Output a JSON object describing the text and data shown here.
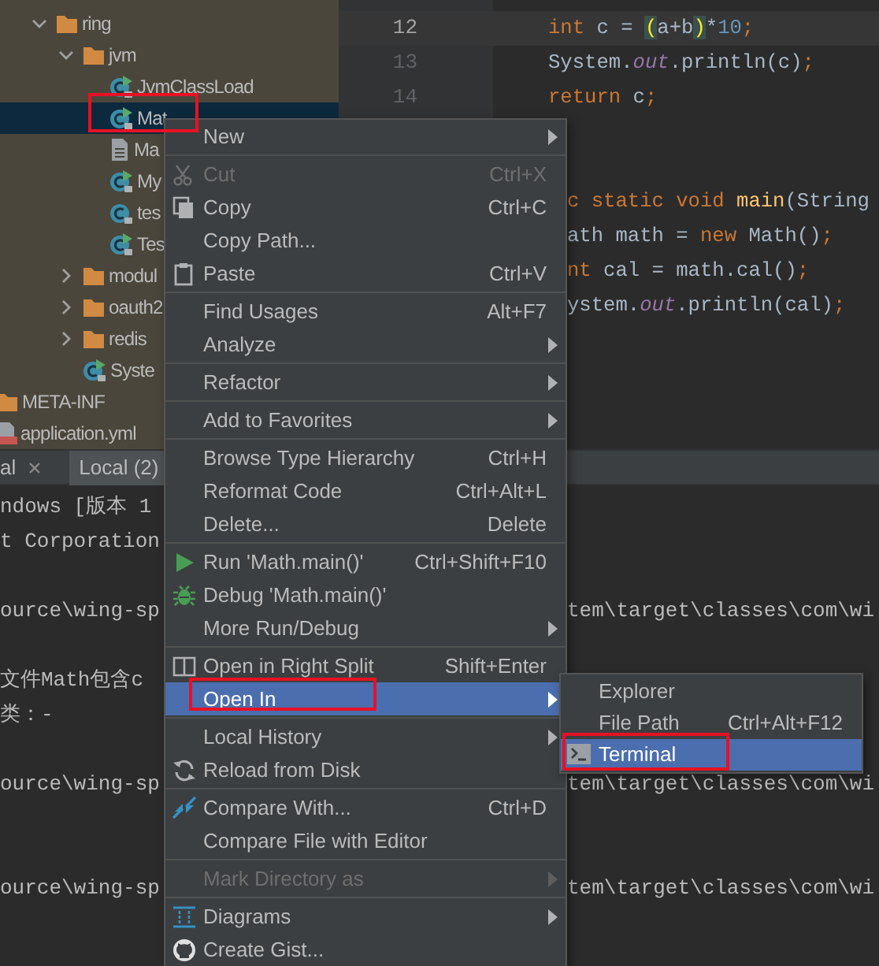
{
  "project_tree": [
    {
      "label": "ring",
      "kind": "folder",
      "expanded": true,
      "selected": false,
      "annotated": false,
      "children": [
        {
          "label": "jvm",
          "kind": "folder",
          "expanded": true,
          "selected": false,
          "annotated": false,
          "children": [
            {
              "label": "JvmClassLoad",
              "kind": "runnable-class",
              "selected": false,
              "annotated": false
            },
            {
              "label": "Mat",
              "kind": "runnable-class",
              "selected": true,
              "annotated": true
            },
            {
              "label": "Ma",
              "kind": "text-file",
              "selected": false,
              "annotated": false
            },
            {
              "label": "My",
              "kind": "runnable-class",
              "selected": false,
              "annotated": false
            },
            {
              "label": "tes",
              "kind": "class",
              "selected": false,
              "annotated": false
            },
            {
              "label": "Tes",
              "kind": "runnable-class",
              "selected": false,
              "annotated": false
            }
          ]
        },
        {
          "label": "modul",
          "kind": "folder",
          "expanded": false,
          "selected": false,
          "annotated": false
        },
        {
          "label": "oauth2",
          "kind": "folder",
          "expanded": false,
          "selected": false,
          "annotated": false
        },
        {
          "label": "redis",
          "kind": "folder",
          "expanded": false,
          "selected": false,
          "annotated": false
        },
        {
          "label": "Syste",
          "kind": "runnable-class",
          "selected": false,
          "annotated": false
        }
      ]
    },
    {
      "label": "META-INF",
      "kind": "folder",
      "selected": false,
      "annotated": false
    },
    {
      "label": "application.yml",
      "kind": "yaml-file",
      "selected": false,
      "annotated": false
    }
  ],
  "editor": {
    "lines": [
      {
        "number": "12",
        "current": true,
        "covered": false,
        "tokens": [
          {
            "text": "int",
            "kind": "keyword"
          },
          {
            "text": " c = ",
            "kind": "text"
          },
          {
            "text": "(",
            "kind": "brace"
          },
          {
            "text": "a+b",
            "kind": "text"
          },
          {
            "text": ")",
            "kind": "brace"
          },
          {
            "text": "*",
            "kind": "text"
          },
          {
            "text": "10",
            "kind": "number"
          },
          {
            "text": ";",
            "kind": "keyword"
          }
        ]
      },
      {
        "number": "13",
        "current": false,
        "covered": false,
        "tokens": [
          {
            "text": "System.",
            "kind": "text"
          },
          {
            "text": "out",
            "kind": "field"
          },
          {
            "text": ".println(c)",
            "kind": "text"
          },
          {
            "text": ";",
            "kind": "keyword"
          }
        ]
      },
      {
        "number": "14",
        "current": false,
        "covered": false,
        "tokens": [
          {
            "text": "return",
            "kind": "keyword"
          },
          {
            "text": " c",
            "kind": "text"
          },
          {
            "text": ";",
            "kind": "keyword"
          }
        ]
      },
      {
        "current": false,
        "covered": true,
        "tokens": [
          {
            "text": "c static void ",
            "kind": "keyword"
          },
          {
            "text": "main",
            "kind": "method"
          },
          {
            "text": "(String",
            "kind": "text"
          }
        ]
      },
      {
        "current": false,
        "covered": true,
        "tokens": [
          {
            "text": "ath math = ",
            "kind": "text"
          },
          {
            "text": "new",
            "kind": "keyword"
          },
          {
            "text": " Math()",
            "kind": "text"
          },
          {
            "text": ";",
            "kind": "keyword"
          }
        ]
      },
      {
        "current": false,
        "covered": true,
        "tokens": [
          {
            "text": "nt",
            "kind": "keyword"
          },
          {
            "text": " cal = math.cal()",
            "kind": "text"
          },
          {
            "text": ";",
            "kind": "keyword"
          }
        ]
      },
      {
        "current": false,
        "covered": true,
        "tokens": [
          {
            "text": "ystem.",
            "kind": "text"
          },
          {
            "text": "out",
            "kind": "field"
          },
          {
            "text": ".println(cal)",
            "kind": "text"
          },
          {
            "text": ";",
            "kind": "keyword"
          }
        ]
      }
    ]
  },
  "terminal": {
    "tabs": [
      {
        "label": "al",
        "closable": true,
        "selected": false
      },
      {
        "label": "Local (2)",
        "closable": false,
        "selected": true
      }
    ],
    "lines": [
      {
        "kind": "text",
        "left": "ndows [版本 1"
      },
      {
        "kind": "text",
        "left": "t Corporation"
      },
      {
        "kind": "blank"
      },
      {
        "kind": "text",
        "left": "ource\\wing-sp",
        "right": "tem\\target\\classes\\com\\wi"
      },
      {
        "kind": "blank"
      },
      {
        "kind": "text",
        "left": "文件Math包含c"
      },
      {
        "kind": "text",
        "left": "类：-"
      },
      {
        "kind": "blank"
      },
      {
        "kind": "text",
        "left": "ource\\wing-sp",
        "right": "tem\\target\\classes\\com\\wi"
      },
      {
        "kind": "blank"
      },
      {
        "kind": "blank"
      },
      {
        "kind": "text",
        "left": "ource\\wing-sp",
        "right": "tem\\target\\classes\\com\\wi"
      }
    ]
  },
  "context_menu": {
    "groups": [
      [
        {
          "label": "New",
          "kind": "plain",
          "submenu": true,
          "disabled": false,
          "selected": false,
          "annotated": false
        }
      ],
      [
        {
          "label": "Cut",
          "kind": "cut",
          "shortcut": "Ctrl+X",
          "submenu": false,
          "disabled": true,
          "selected": false,
          "annotated": false
        },
        {
          "label": "Copy",
          "kind": "copy",
          "shortcut": "Ctrl+C",
          "submenu": false,
          "disabled": false,
          "selected": false,
          "annotated": false
        },
        {
          "label": "Copy Path...",
          "kind": "plain",
          "submenu": false,
          "disabled": false,
          "selected": false,
          "annotated": false
        },
        {
          "label": "Paste",
          "kind": "paste",
          "shortcut": "Ctrl+V",
          "submenu": false,
          "disabled": false,
          "selected": false,
          "annotated": false
        }
      ],
      [
        {
          "label": "Find Usages",
          "kind": "plain",
          "shortcut": "Alt+F7",
          "submenu": false,
          "disabled": false,
          "selected": false,
          "annotated": false
        },
        {
          "label": "Analyze",
          "kind": "plain",
          "submenu": true,
          "disabled": false,
          "selected": false,
          "annotated": false
        }
      ],
      [
        {
          "label": "Refactor",
          "kind": "plain",
          "submenu": true,
          "disabled": false,
          "selected": false,
          "annotated": false
        }
      ],
      [
        {
          "label": "Add to Favorites",
          "kind": "plain",
          "submenu": true,
          "disabled": false,
          "selected": false,
          "annotated": false
        }
      ],
      [
        {
          "label": "Browse Type Hierarchy",
          "kind": "plain",
          "shortcut": "Ctrl+H",
          "submenu": false,
          "disabled": false,
          "selected": false,
          "annotated": false
        },
        {
          "label": "Reformat Code",
          "kind": "plain",
          "shortcut": "Ctrl+Alt+L",
          "submenu": false,
          "disabled": false,
          "selected": false,
          "annotated": false
        },
        {
          "label": "Delete...",
          "kind": "plain",
          "shortcut": "Delete",
          "submenu": false,
          "disabled": false,
          "selected": false,
          "annotated": false
        }
      ],
      [
        {
          "label": "Run 'Math.main()'",
          "kind": "run",
          "shortcut": "Ctrl+Shift+F10",
          "submenu": false,
          "disabled": false,
          "selected": false,
          "annotated": false
        },
        {
          "label": "Debug 'Math.main()'",
          "kind": "debug",
          "submenu": false,
          "disabled": false,
          "selected": false,
          "annotated": false
        },
        {
          "label": "More Run/Debug",
          "kind": "plain",
          "submenu": true,
          "disabled": false,
          "selected": false,
          "annotated": false
        }
      ],
      [
        {
          "label": "Open in Right Split",
          "kind": "split",
          "shortcut": "Shift+Enter",
          "submenu": false,
          "disabled": false,
          "selected": false,
          "annotated": false
        },
        {
          "label": "Open In",
          "kind": "plain",
          "submenu": true,
          "disabled": false,
          "selected": true,
          "annotated": true
        }
      ],
      [
        {
          "label": "Local History",
          "kind": "plain",
          "submenu": true,
          "disabled": false,
          "selected": false,
          "annotated": false
        },
        {
          "label": "Reload from Disk",
          "kind": "reload",
          "submenu": false,
          "disabled": false,
          "selected": false,
          "annotated": false
        }
      ],
      [
        {
          "label": "Compare With...",
          "kind": "compare",
          "shortcut": "Ctrl+D",
          "submenu": false,
          "disabled": false,
          "selected": false,
          "annotated": false
        },
        {
          "label": "Compare File with Editor",
          "kind": "plain",
          "submenu": false,
          "disabled": false,
          "selected": false,
          "annotated": false
        }
      ],
      [
        {
          "label": "Mark Directory as",
          "kind": "plain",
          "submenu": true,
          "disabled": true,
          "selected": false,
          "annotated": false
        }
      ],
      [
        {
          "label": "Diagrams",
          "kind": "diagram",
          "submenu": true,
          "disabled": false,
          "selected": false,
          "annotated": false
        },
        {
          "label": "Create Gist...",
          "kind": "gist",
          "submenu": false,
          "disabled": false,
          "selected": false,
          "annotated": false
        }
      ]
    ]
  },
  "submenu": {
    "items": [
      {
        "label": "Explorer",
        "kind": "plain",
        "selected": false,
        "annotated": false
      },
      {
        "label": "File Path",
        "kind": "plain",
        "shortcut": "Ctrl+Alt+F12",
        "selected": false,
        "annotated": false
      },
      {
        "label": "Terminal",
        "kind": "terminal",
        "selected": true,
        "annotated": true
      }
    ]
  }
}
